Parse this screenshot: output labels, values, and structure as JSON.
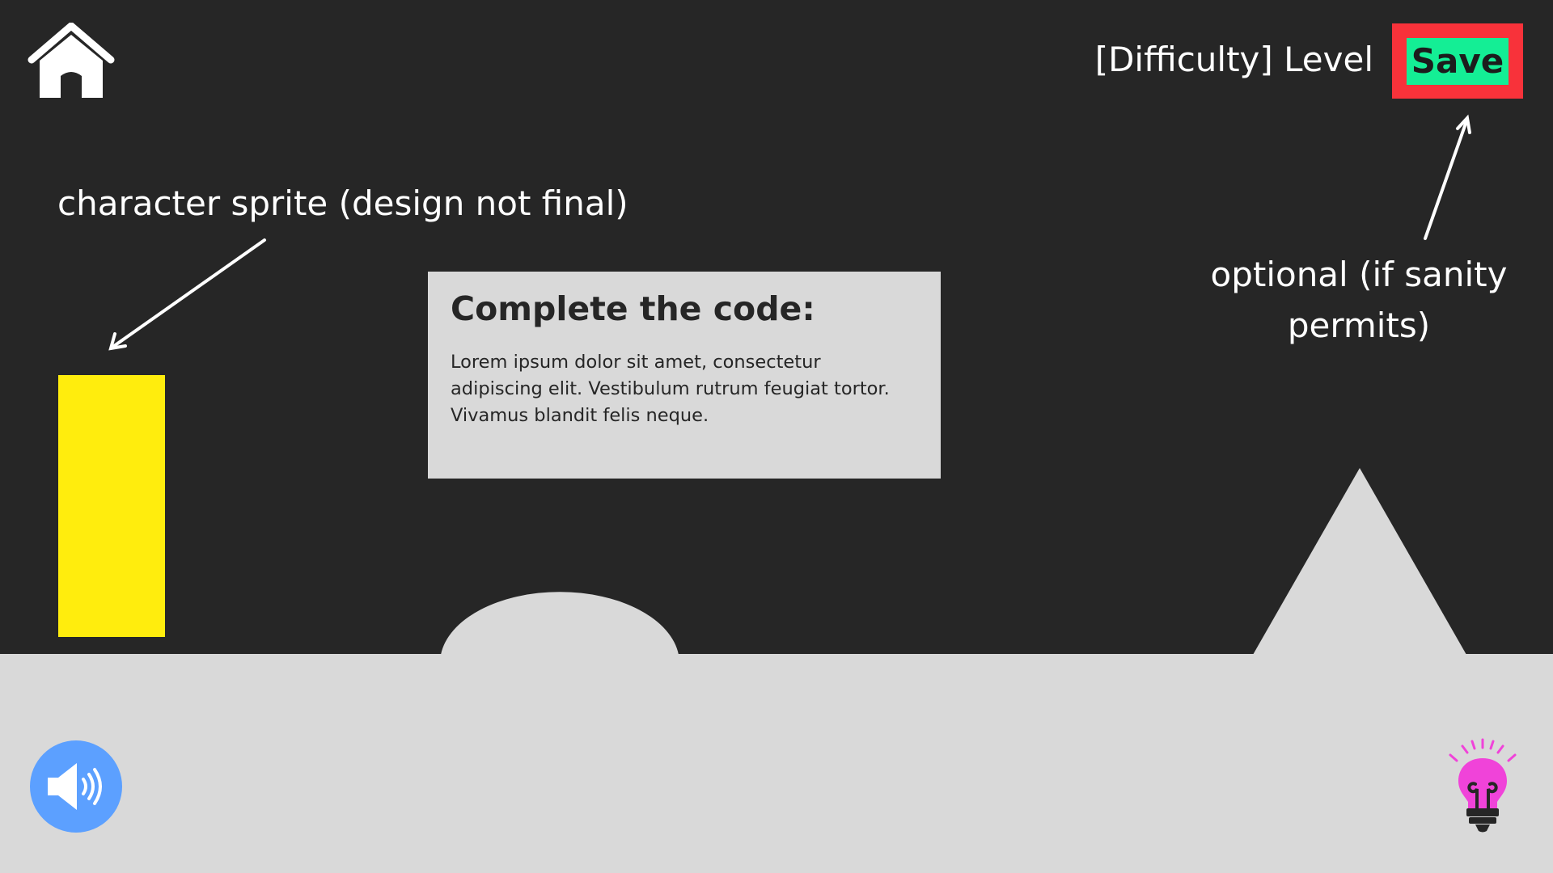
{
  "header": {
    "level_label": "[Difficulty] Level",
    "save_label": "Save",
    "home_icon": "home-icon"
  },
  "annotations": {
    "sprite_note": "character sprite (design not final)",
    "optional_note": "optional (if sanity permits)"
  },
  "code_panel": {
    "title": "Complete the code:",
    "body": "Lorem ipsum dolor sit amet, consectetur adipiscing elit. Vestibulum rutrum feugiat tortor. Vivamus blandit felis neque."
  },
  "controls": {
    "sound_icon": "speaker-volume-icon",
    "hint_icon": "lightbulb-icon"
  },
  "colors": {
    "background": "#262626",
    "ground": "#d9d9d9",
    "sprite": "#ffed0d",
    "save_frame": "#f8323a",
    "save_button": "#14ee95",
    "sound_button": "#5ca0ff",
    "hint_bulb": "#f043d9"
  }
}
